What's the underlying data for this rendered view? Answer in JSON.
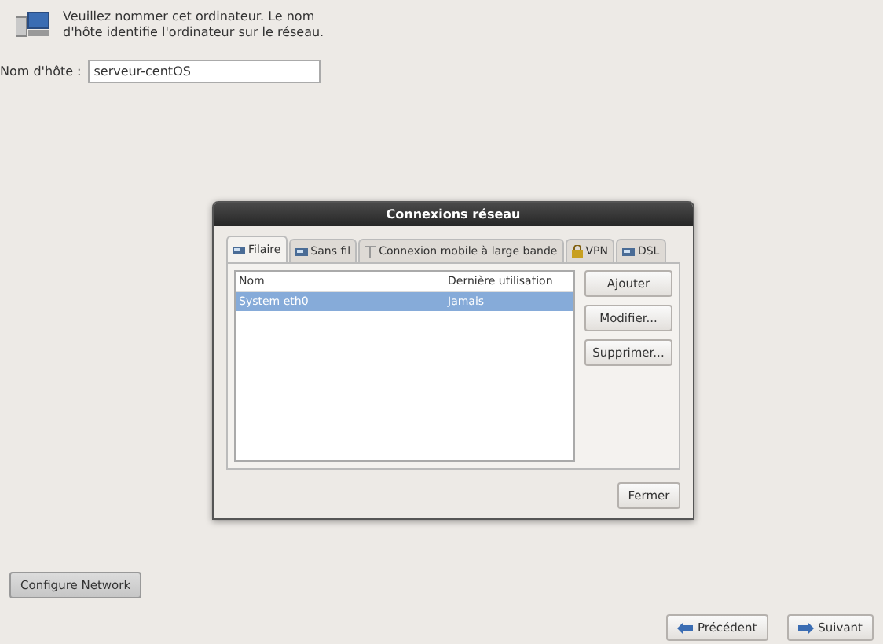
{
  "header": {
    "text": "Veuillez nommer cet ordinateur. Le nom d'hôte identifie l'ordinateur sur le réseau."
  },
  "hostname": {
    "label": "Nom d'hôte :",
    "value": "serveur-centOS"
  },
  "dialog": {
    "title": "Connexions réseau",
    "tabs": [
      {
        "label": "Filaire",
        "selected": true,
        "kind": "wired"
      },
      {
        "label": "Sans fil",
        "selected": false,
        "kind": "wired"
      },
      {
        "label": "Connexion mobile à large bande",
        "selected": false,
        "kind": "antenna"
      },
      {
        "label": "VPN",
        "selected": false,
        "kind": "lock"
      },
      {
        "label": "DSL",
        "selected": false,
        "kind": "wired"
      }
    ],
    "table": {
      "columns": [
        "Nom",
        "Dernière utilisation"
      ],
      "rows": [
        {
          "cells": [
            "System eth0",
            "Jamais"
          ],
          "selected": true
        }
      ]
    },
    "buttons": [
      "Ajouter",
      "Modifier...",
      "Supprimer..."
    ],
    "close_button": "Fermer"
  },
  "configure_button": "Configure Network",
  "nav": [
    {
      "label": "Précédent",
      "kind": "back"
    },
    {
      "label": "Suivant",
      "kind": "next"
    }
  ]
}
